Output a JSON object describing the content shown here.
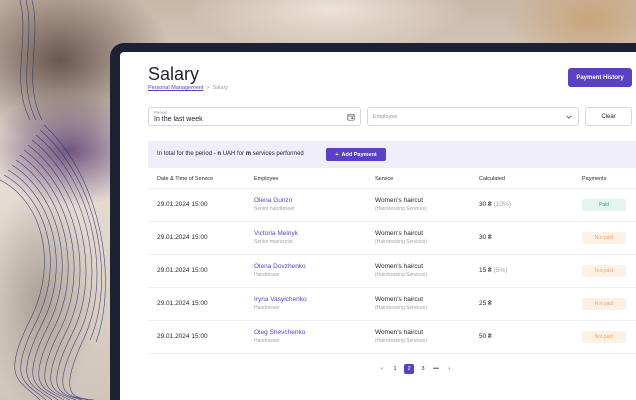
{
  "page": {
    "title": "Salary",
    "breadcrumb": {
      "parent": "Personal Management",
      "current": "Salary"
    },
    "payment_history_label": "Payment History"
  },
  "filters": {
    "period_label": "Period",
    "period_value": "In the last week",
    "employee_placeholder": "Employee",
    "clear_label": "Clear"
  },
  "summary": {
    "prefix": "In total for the period - ",
    "amount": "n",
    "middle": " UAH for ",
    "count": "m",
    "suffix": " services performed",
    "add_payment_label": "Add Payment"
  },
  "table": {
    "headers": [
      "Date & Time of Service",
      "Employee",
      "Service",
      "Calculated",
      "Payments"
    ],
    "rows": [
      {
        "datetime": "29.01.2024 15:00",
        "employee": "Olena Gunzo",
        "role": "Senior hairdresser",
        "service": "Women's haircut",
        "category": "(Hairdressing Services)",
        "amount": "30 ₴",
        "percent": "(10%)",
        "status": "Paid"
      },
      {
        "datetime": "29.01.2024 15:00",
        "employee": "Victoria Melnyk",
        "role": "Senior manicurist",
        "service": "Women's haircut",
        "category": "(Hairdressing Services)",
        "amount": "30 ₴",
        "percent": "",
        "status": "Not paid"
      },
      {
        "datetime": "29.01.2024 15:00",
        "employee": "Olena Dovzhenko",
        "role": "Hairdresser",
        "service": "Women's haircut",
        "category": "(Hairdressing Services)",
        "amount": "15 ₴",
        "percent": "(5%)",
        "status": "Not paid"
      },
      {
        "datetime": "29.01.2024 15:00",
        "employee": "Iryna Vasylchenko",
        "role": "Hairdresser",
        "service": "Women's haircut",
        "category": "(Hairdressing Services)",
        "amount": "25 ₴",
        "percent": "",
        "status": "Not paid"
      },
      {
        "datetime": "29.01.2024 15:00",
        "employee": "Oleg Shevchenko",
        "role": "Hairdresser",
        "service": "Women's haircut",
        "category": "(Hairdressing Services)",
        "amount": "50 ₴",
        "percent": "",
        "status": "Not paid"
      }
    ]
  },
  "pagination": {
    "prev": "‹",
    "pages": [
      "1",
      "2",
      "3"
    ],
    "ellipsis": "•••",
    "next": "›",
    "current": "2"
  },
  "colors": {
    "accent": "#5b3fc4",
    "paid_bg": "#e3f6ee",
    "paid_text": "#2fa56a",
    "notpaid_bg": "#fdf1e5",
    "notpaid_text": "#f0a770"
  },
  "icons": {
    "period": "calendar-icon",
    "employee": "chevron-down-icon",
    "add": "plus-icon"
  }
}
